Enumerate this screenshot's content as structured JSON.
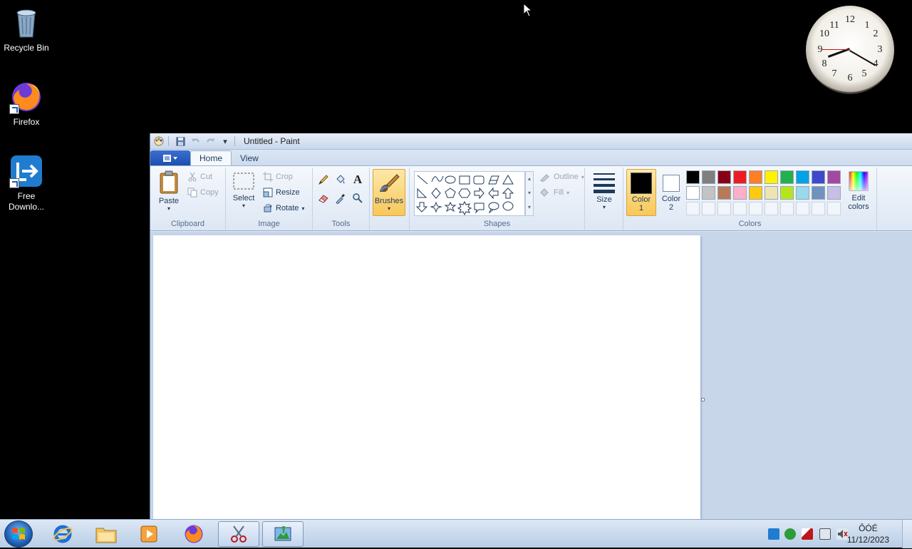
{
  "desktop": {
    "icons": [
      {
        "label": "Recycle Bin",
        "icon": "recycle-bin-icon"
      },
      {
        "label": "Firefox",
        "icon": "firefox-icon"
      },
      {
        "label": "Free Downlo...",
        "icon": "free-download-manager-icon"
      }
    ]
  },
  "clock_gadget": {
    "numbers": [
      "12",
      "1",
      "2",
      "3",
      "4",
      "5",
      "6",
      "7",
      "8",
      "9",
      "10",
      "11"
    ],
    "hour": 8,
    "minute": 20
  },
  "paint": {
    "title": "Untitled - Paint",
    "tabs": [
      {
        "label": "Home",
        "active": true
      },
      {
        "label": "View",
        "active": false
      }
    ],
    "clipboard": {
      "group_label": "Clipboard",
      "paste": "Paste",
      "cut": "Cut",
      "copy": "Copy"
    },
    "image": {
      "group_label": "Image",
      "select": "Select",
      "crop": "Crop",
      "resize": "Resize",
      "rotate": "Rotate"
    },
    "tools": {
      "group_label": "Tools"
    },
    "brushes": {
      "label": "Brushes"
    },
    "shapes": {
      "group_label": "Shapes",
      "outline": "Outline",
      "fill": "Fill"
    },
    "size": {
      "label": "Size"
    },
    "colors": {
      "group_label": "Colors",
      "color1_line1": "Color",
      "color1_line2": "1",
      "color2_line1": "Color",
      "color2_line2": "2",
      "edit_line1": "Edit",
      "edit_line2": "colors",
      "color1": "#000000",
      "color2": "#ffffff",
      "palette_row1": [
        "#000000",
        "#7f7f7f",
        "#880015",
        "#ed1c24",
        "#ff7f27",
        "#fff200",
        "#22b14c",
        "#00a2e8",
        "#3f48cc",
        "#a349a4"
      ],
      "palette_row2": [
        "#ffffff",
        "#c3c3c3",
        "#b97a57",
        "#ffaec9",
        "#ffc90e",
        "#efe4b0",
        "#b5e61d",
        "#99d9ea",
        "#7092be",
        "#c8bfe7"
      ]
    }
  },
  "taskbar": {
    "time": "ÔÓÉ",
    "date": "11/12/2023",
    "pinned": [
      {
        "name": "internet-explorer",
        "running": false
      },
      {
        "name": "file-explorer",
        "running": false
      },
      {
        "name": "media-player",
        "running": false
      },
      {
        "name": "firefox",
        "running": false
      },
      {
        "name": "snipping-tool",
        "running": true
      },
      {
        "name": "paint",
        "running": true
      }
    ]
  }
}
